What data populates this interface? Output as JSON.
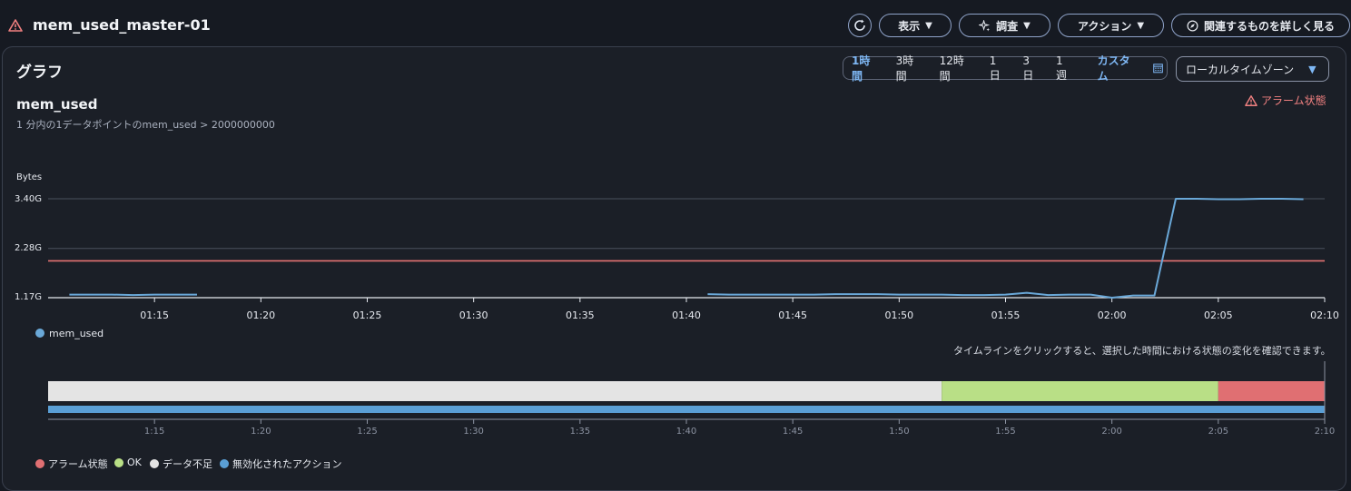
{
  "header": {
    "title": "mem_used_master-01",
    "buttons": {
      "view": "表示",
      "investigate": "調査",
      "actions": "アクション",
      "related": "関連するものを詳しく見る"
    }
  },
  "panel": {
    "title": "グラフ",
    "ranges": [
      "1時間",
      "3時間",
      "12時間",
      "1日",
      "3日",
      "1週"
    ],
    "active_range": "1時間",
    "custom_label": "カスタム",
    "timezone": "ローカルタイムゾーン"
  },
  "metric": {
    "name": "mem_used",
    "description": "1 分内の1データポイントのmem_used > 2000000000",
    "alarm_state": "アラーム状態"
  },
  "colors": {
    "line": "#6aa8d8",
    "threshold": "#e57373",
    "alarm": "#e06f72",
    "ok": "#b9df86",
    "insufficient": "#e4e4e4",
    "disabled": "#5a9fd6"
  },
  "chart_data": {
    "type": "line",
    "ylabel": "Bytes",
    "y_ticks": [
      "1.17G",
      "2.28G",
      "3.40G"
    ],
    "y_tick_values": [
      1.17,
      2.28,
      3.4
    ],
    "x_ticks": [
      "01:15",
      "01:20",
      "01:25",
      "01:30",
      "01:35",
      "01:40",
      "01:45",
      "01:50",
      "01:55",
      "02:00",
      "02:05",
      "02:10"
    ],
    "threshold": 2.0,
    "series": [
      {
        "name": "mem_used",
        "segments": [
          [
            [
              "01:11",
              1.24
            ],
            [
              "01:12",
              1.24
            ],
            [
              "01:13",
              1.24
            ],
            [
              "01:14",
              1.23
            ],
            [
              "01:15",
              1.24
            ],
            [
              "01:16",
              1.24
            ],
            [
              "01:17",
              1.24
            ]
          ],
          [
            [
              "01:41",
              1.25
            ],
            [
              "01:42",
              1.24
            ],
            [
              "01:43",
              1.24
            ],
            [
              "01:44",
              1.24
            ],
            [
              "01:45",
              1.24
            ],
            [
              "01:46",
              1.24
            ],
            [
              "01:47",
              1.25
            ],
            [
              "01:48",
              1.25
            ],
            [
              "01:49",
              1.25
            ],
            [
              "01:50",
              1.24
            ],
            [
              "01:51",
              1.24
            ],
            [
              "01:52",
              1.24
            ],
            [
              "01:53",
              1.23
            ],
            [
              "01:54",
              1.23
            ],
            [
              "01:55",
              1.24
            ],
            [
              "01:56",
              1.28
            ],
            [
              "01:57",
              1.23
            ],
            [
              "01:58",
              1.24
            ],
            [
              "01:59",
              1.24
            ],
            [
              "02:00",
              1.17
            ],
            [
              "02:01",
              1.22
            ],
            [
              "02:02",
              1.22
            ],
            [
              "02:03",
              3.4
            ],
            [
              "02:04",
              3.4
            ],
            [
              "02:05",
              3.39
            ],
            [
              "02:06",
              3.39
            ],
            [
              "02:07",
              3.4
            ],
            [
              "02:08",
              3.4
            ],
            [
              "02:09",
              3.39
            ]
          ]
        ]
      }
    ],
    "legend": [
      "mem_used"
    ]
  },
  "timeline": {
    "hint": "タイムラインをクリックすると、選択した時間における状態の変化を確認できます。",
    "ticks": [
      "1:15",
      "1:20",
      "1:25",
      "1:30",
      "1:35",
      "1:40",
      "1:45",
      "1:50",
      "1:55",
      "2:00",
      "2:05",
      "2:10"
    ],
    "states": [
      {
        "state": "insufficient",
        "start": "01:10",
        "end": "01:52"
      },
      {
        "state": "ok",
        "start": "01:52",
        "end": "02:05"
      },
      {
        "state": "alarm",
        "start": "02:05",
        "end": "02:10"
      }
    ],
    "legend": [
      "アラーム状態",
      "OK",
      "データ不足",
      "無効化されたアクション"
    ]
  }
}
